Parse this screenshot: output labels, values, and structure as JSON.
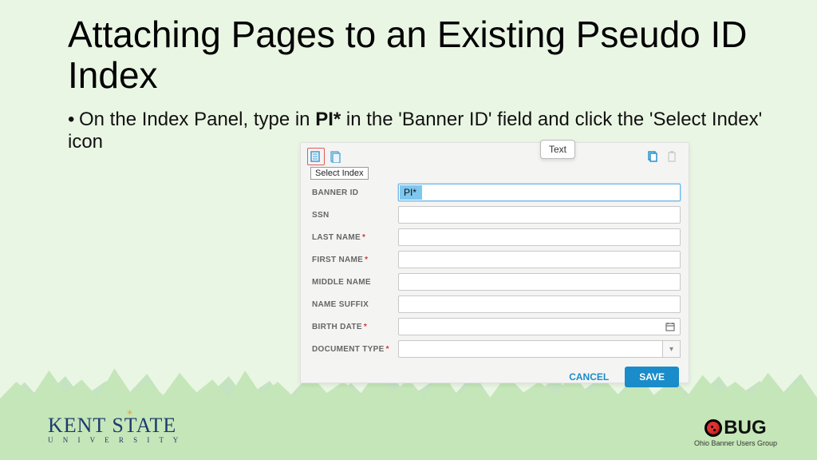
{
  "title": "Attaching Pages to an Existing Pseudo ID Index",
  "bullet_pre": "On the Index Panel, type in ",
  "bullet_bold": "PI*",
  "bullet_post": " in the 'Banner ID' field and click the 'Select Index' icon",
  "panel": {
    "tooltip": "Select Index",
    "text_tip": "Text",
    "banner_value": "PI*",
    "fields": [
      {
        "label": "BANNER ID",
        "required": false
      },
      {
        "label": "SSN",
        "required": false
      },
      {
        "label": "LAST NAME",
        "required": true
      },
      {
        "label": "FIRST NAME",
        "required": true
      },
      {
        "label": "MIDDLE NAME",
        "required": false
      },
      {
        "label": "NAME SUFFIX",
        "required": false
      },
      {
        "label": "BIRTH DATE",
        "required": true
      },
      {
        "label": "DOCUMENT TYPE",
        "required": true
      }
    ],
    "cancel": "CANCEL",
    "save": "SAVE"
  },
  "logos": {
    "kent_main": "KENT STATE",
    "kent_sub": "U N I V E R S I T Y",
    "obug_main": "BUG",
    "obug_sub": "Ohio Banner Users Group"
  }
}
